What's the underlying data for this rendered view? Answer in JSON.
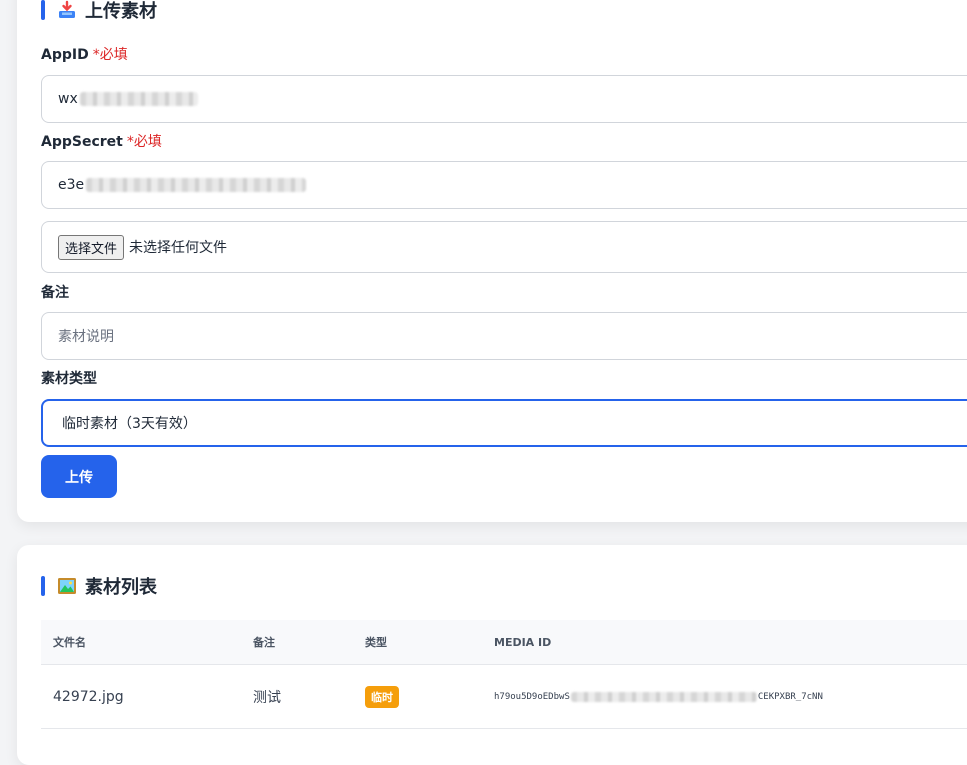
{
  "upload": {
    "title": "上传素材",
    "appid_label": "AppID",
    "appid_required": "*必填",
    "appid_value_prefix": "wx",
    "appsecret_label": "AppSecret",
    "appsecret_required": "*必填",
    "appsecret_value_prefix": "e3e",
    "file_button": "选择文件",
    "file_status": "未选择任何文件",
    "remark_label": "备注",
    "remark_placeholder": "素材说明",
    "type_label": "素材类型",
    "type_selected": "临时素材（3天有效）",
    "submit_label": "上传"
  },
  "list": {
    "title": "素材列表",
    "columns": [
      "文件名",
      "备注",
      "类型",
      "MEDIA ID"
    ],
    "rows": [
      {
        "filename": "42972.jpg",
        "remark": "测试",
        "type": "临时",
        "media_id_start": "h79ou5D9oEDbwS",
        "media_id_end": "CEKPXBR_7cNN"
      }
    ]
  },
  "colors": {
    "accent": "#2563eb",
    "required": "#dc2626",
    "badge_temp": "#f59e0b"
  },
  "icons": {
    "upload_section": "inbox-tray-icon",
    "list_section": "framed-picture-icon"
  }
}
